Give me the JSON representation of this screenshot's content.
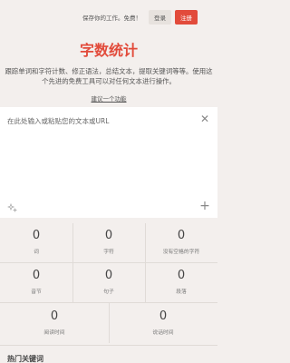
{
  "header": {
    "save_prompt": "保存你的工作。免费！",
    "login_label": "登录",
    "signup_label": "注册"
  },
  "hero": {
    "title": "字数统计",
    "description": "跟踪单词和字符计数、修正语法，总结文本，提取关键词等等。使用这个先进的免费工具可以对任何文本进行操作。",
    "suggest_link": "建议一个功能"
  },
  "editor": {
    "placeholder": "在此处输入或粘贴您的文本或URL"
  },
  "stats": {
    "words": {
      "value": "0",
      "label": "词"
    },
    "chars": {
      "value": "0",
      "label": "字符"
    },
    "chars_no_space": {
      "value": "0",
      "label": "没有空格的字符"
    },
    "syllables": {
      "value": "0",
      "label": "音节"
    },
    "sentences": {
      "value": "0",
      "label": "句子"
    },
    "paragraphs": {
      "value": "0",
      "label": "段落"
    },
    "reading_time": {
      "value": "0",
      "label": "阅读时间"
    },
    "speaking_time": {
      "value": "0",
      "label": "说话时间"
    }
  },
  "keywords": {
    "title": "热门关键词"
  },
  "colors": {
    "accent": "#e24b3b",
    "background": "#f3efed"
  }
}
